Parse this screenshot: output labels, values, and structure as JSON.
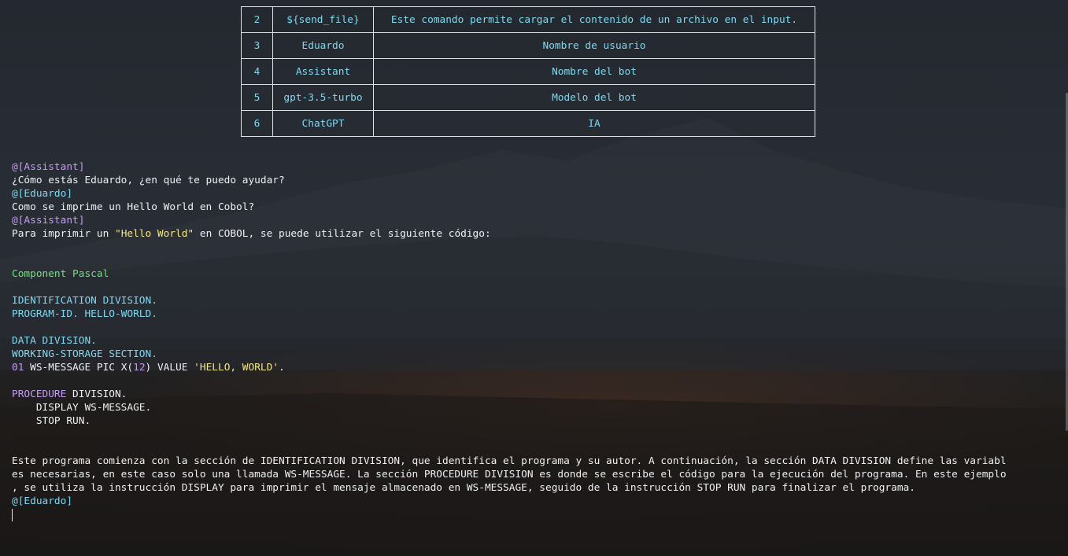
{
  "table": {
    "rows": [
      {
        "num": "2",
        "key": "${send_file}",
        "desc": "Este comando permite cargar el contenido de un archivo en el input."
      },
      {
        "num": "3",
        "key": "Eduardo",
        "desc": "Nombre de usuario"
      },
      {
        "num": "4",
        "key": "Assistant",
        "desc": "Nombre del bot"
      },
      {
        "num": "5",
        "key": "gpt-3.5-turbo",
        "desc": "Modelo del bot"
      },
      {
        "num": "6",
        "key": "ChatGPT",
        "desc": "IA"
      }
    ]
  },
  "chat": {
    "assistant_tag": "@[Assistant]",
    "user_tag": "@[Eduardo]",
    "msg1": "¿Cómo estás Eduardo, ¿en qué te puedo ayudar?",
    "msg2": "Como se imprime un Hello World en Cobol?",
    "msg3_pre": "Para imprimir un ",
    "msg3_str": "\"Hello World\"",
    "msg3_post": " en COBOL, se puede utilizar el siguiente código:",
    "code_lang": "Component Pascal",
    "code": {
      "l1": "IDENTIFICATION DIVISION.",
      "l2": "PROGRAM-ID. HELLO-WORLD.",
      "l3": "DATA DIVISION.",
      "l4": "WORKING-STORAGE SECTION.",
      "l5_num": "01",
      "l5_mid": " WS-MESSAGE PIC X(",
      "l5_len": "12",
      "l5_mid2": ") VALUE ",
      "l5_str": "'HELLO, WORLD'",
      "l5_end": ".",
      "l6_kw": "PROCEDURE",
      "l6_rest": " DIVISION.",
      "l7": "    DISPLAY WS-MESSAGE.",
      "l8": "    STOP RUN."
    },
    "explain1": "Este programa comienza con la sección de IDENTIFICATION DIVISION, que identifica el programa y su autor. A continuación, la sección DATA DIVISION define las variabl",
    "explain2": "es necesarias, en este caso solo una llamada WS-MESSAGE. La sección PROCEDURE DIVISION es donde se escribe el código para la ejecución del programa. En este ejemplo",
    "explain3": ", se utiliza la instrucción DISPLAY para imprimir el mensaje almacenado en WS-MESSAGE, seguido de la instrucción STOP RUN para finalizar el programa."
  },
  "colors": {
    "assistant": "#c49cf2",
    "user": "#7fd8ef",
    "string": "#f2e58a",
    "language": "#6ee27a"
  }
}
